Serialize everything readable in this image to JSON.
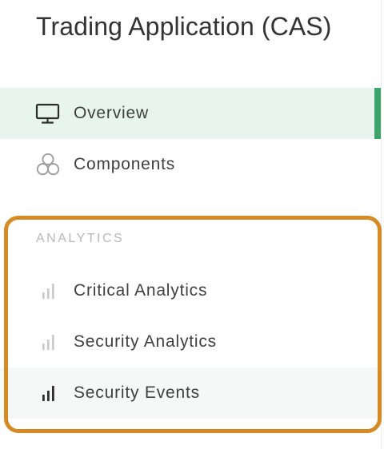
{
  "app": {
    "title": "Trading Application (CAS)"
  },
  "nav": {
    "overview": {
      "label": "Overview",
      "icon": "monitor-icon"
    },
    "components": {
      "label": "Components",
      "icon": "components-icon"
    }
  },
  "analytics": {
    "section_label": "ANALYTICS",
    "items": [
      {
        "label": "Critical Analytics",
        "icon": "bar-chart-icon"
      },
      {
        "label": "Security Analytics",
        "icon": "bar-chart-icon"
      },
      {
        "label": "Security Events",
        "icon": "bar-chart-icon"
      }
    ]
  },
  "colors": {
    "active_accent": "#3fa46a",
    "active_bg": "#e8f4ee",
    "highlight_border": "#d58a24"
  }
}
